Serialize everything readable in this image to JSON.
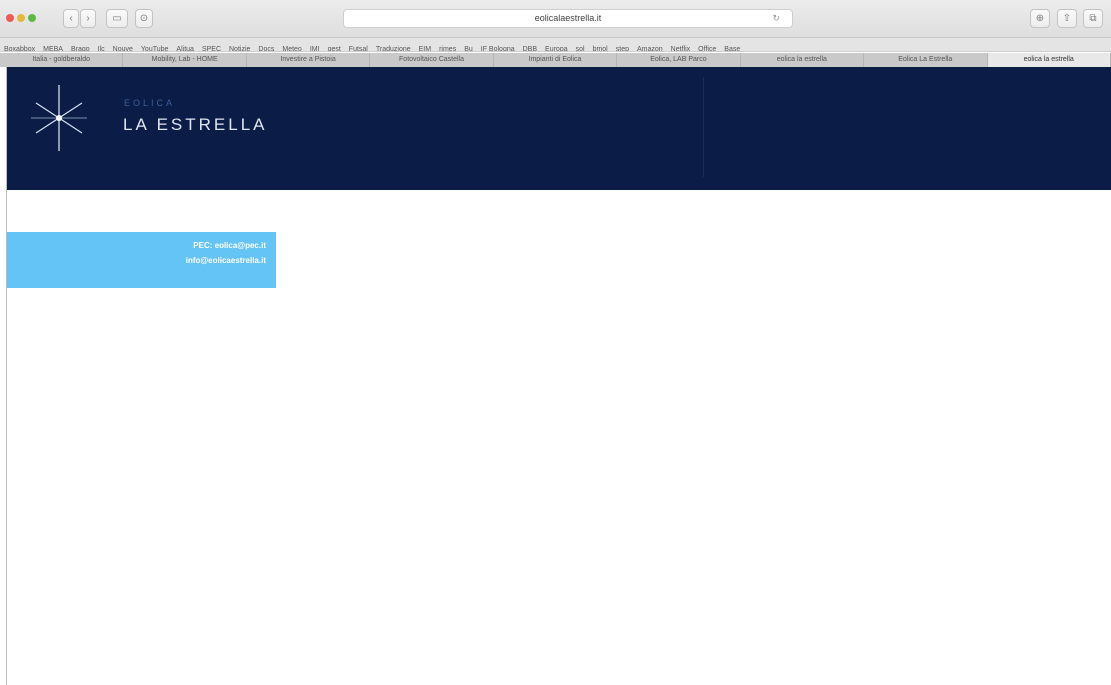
{
  "browser": {
    "url": "eolicalaestrella.it",
    "favorites": [
      "Boxabbox",
      "MEBA",
      "Brago",
      "Ilc",
      "Nouve",
      "YouTube",
      "Alitua",
      "SPEC",
      "Notizie",
      "Docs",
      "Meteo",
      "IMI",
      "gest",
      "Futsal",
      "Traduzione",
      "EIM",
      "rimes",
      "Bu",
      "IF Bologna",
      "DBB",
      "Europa",
      "sol",
      "bmol",
      "step",
      "Amazon",
      "Netflix",
      "Office",
      "Base"
    ],
    "tabs": [
      {
        "label": "Italia - goldberaldo",
        "active": false
      },
      {
        "label": "Mobility, Lab - HOME",
        "active": false
      },
      {
        "label": "Investire a Pistoia",
        "active": false
      },
      {
        "label": "Fotovoltaico Castella",
        "active": false
      },
      {
        "label": "Impianti di Eolica",
        "active": false
      },
      {
        "label": "Eolica, LAB Parco",
        "active": false
      },
      {
        "label": "eolica la estrella",
        "active": false
      },
      {
        "label": "Eolica La Estrella",
        "active": false
      },
      {
        "label": "eolica la estrella",
        "active": true
      }
    ]
  },
  "hero": {
    "brand_small": "EOLICA",
    "brand_name": "LA ESTRELLA"
  },
  "contact": {
    "line1": "PEC: eolica@pec.it",
    "line2": "info@eolicaestrella.it"
  },
  "colors": {
    "hero_bg": "#0b1c46",
    "contact_bg": "#64c4f5"
  }
}
